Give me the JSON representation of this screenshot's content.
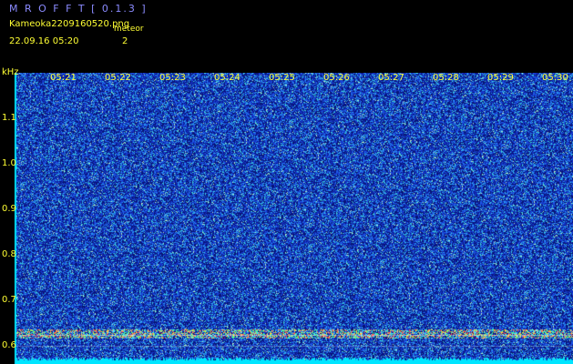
{
  "header": {
    "app_title": "M R O F F T  [ 0.1.3 ]",
    "filename": "Kameoka2209160520.png",
    "datetime": "22.09.16 05:20",
    "meteor_label": "meteor",
    "meteor_count": "2"
  },
  "axis": {
    "unit": "kHz",
    "y_ticks": [
      "1.1",
      "1.0",
      "0.9",
      "0.8",
      "0.7",
      "0.6"
    ],
    "y_values": [
      1.1,
      1.0,
      0.9,
      0.8,
      0.7,
      0.6
    ],
    "x_ticks": [
      "05:21",
      "05:22",
      "05:23",
      "05:24",
      "05:25",
      "05:26",
      "05:27",
      "05:28",
      "05:29",
      "05:30"
    ]
  },
  "colors": {
    "background": "#000000",
    "label": "#ffff33",
    "title": "#8b8bff",
    "noise_base": "#0a1a8a",
    "baseline": "#00e5ff"
  }
}
